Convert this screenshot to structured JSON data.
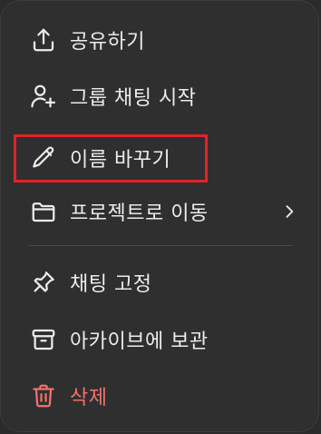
{
  "menu": {
    "items": [
      {
        "id": "share",
        "label": "공유하기",
        "icon": "share-icon"
      },
      {
        "id": "group-chat",
        "label": "그룹 채팅 시작",
        "icon": "add-person-icon"
      },
      {
        "id": "rename",
        "label": "이름 바꾸기",
        "icon": "pencil-icon",
        "highlighted": true
      },
      {
        "id": "move-to-project",
        "label": "프로젝트로 이동",
        "icon": "folder-icon",
        "has_submenu": true
      },
      {
        "id": "pin",
        "label": "채팅 고정",
        "icon": "pin-icon"
      },
      {
        "id": "archive",
        "label": "아카이브에 보관",
        "icon": "archive-icon"
      },
      {
        "id": "delete",
        "label": "삭제",
        "icon": "trash-icon",
        "danger": true
      }
    ]
  },
  "colors": {
    "background": "#2f2f2f",
    "text": "#ececec",
    "danger": "#f0726c",
    "highlight_border": "#e02424",
    "divider": "#4a4a4a"
  }
}
